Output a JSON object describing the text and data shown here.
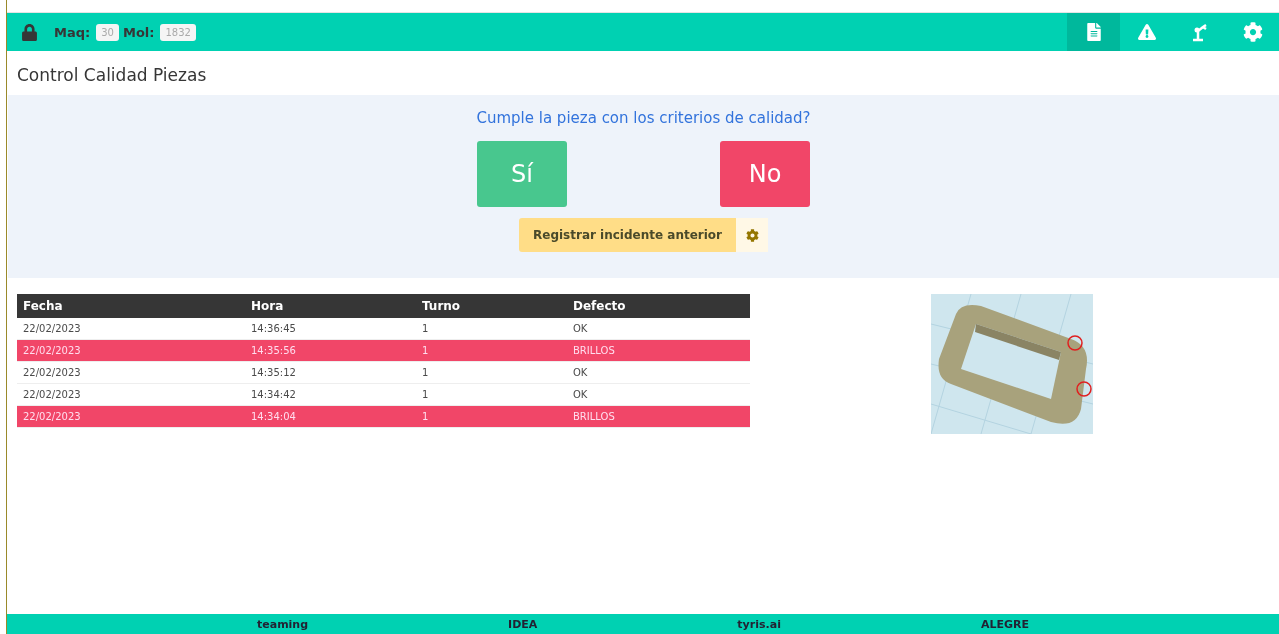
{
  "header": {
    "maq_label": "Maq:",
    "maq_value": "30",
    "mol_label": "Mol:",
    "mol_value": "1832",
    "nav": [
      {
        "selected": true
      },
      {
        "selected": false
      },
      {
        "selected": false
      },
      {
        "selected": false
      }
    ]
  },
  "title": "Control Calidad Piezas",
  "question": {
    "text": "Cumple la pieza con los criterios de calidad?",
    "yes": "Sí",
    "no": "No",
    "register": "Registrar incidente anterior"
  },
  "table": {
    "columns": [
      "Fecha",
      "Hora",
      "Turno",
      "Defecto"
    ],
    "rows": [
      {
        "cells": [
          "22/02/2023",
          "14:36:45",
          "1",
          "OK"
        ],
        "defective": false
      },
      {
        "cells": [
          "22/02/2023",
          "14:35:56",
          "1",
          "BRILLOS"
        ],
        "defective": true
      },
      {
        "cells": [
          "22/02/2023",
          "14:35:12",
          "1",
          "OK"
        ],
        "defective": false
      },
      {
        "cells": [
          "22/02/2023",
          "14:34:42",
          "1",
          "OK"
        ],
        "defective": false
      },
      {
        "cells": [
          "22/02/2023",
          "14:34:04",
          "1",
          "BRILLOS"
        ],
        "defective": true
      }
    ]
  },
  "footer": {
    "logos": [
      "teaming",
      "IDEA",
      "tyris.ai",
      "ALEGRE"
    ]
  }
}
